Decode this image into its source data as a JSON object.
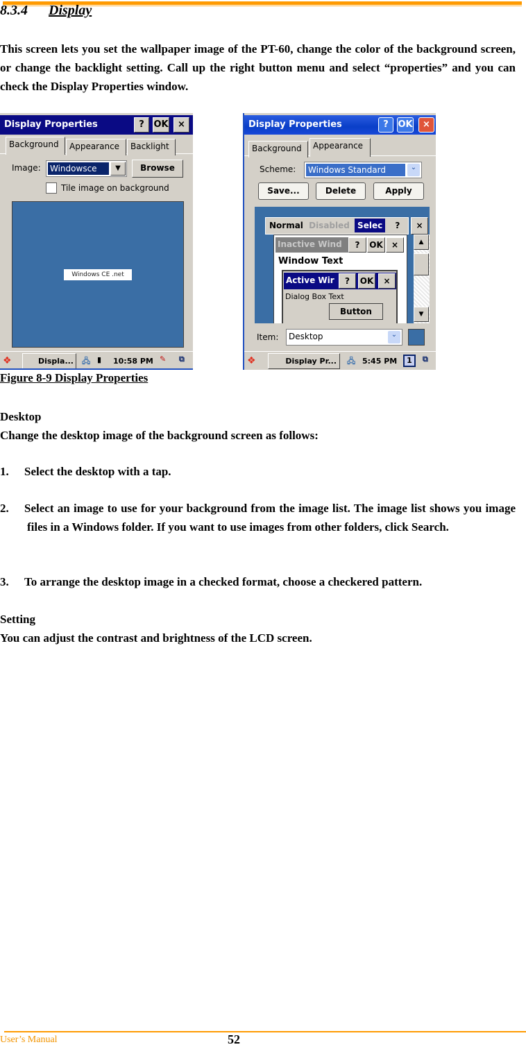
{
  "section": {
    "number": "8.3.4",
    "title": "Display"
  },
  "intro": "This screen lets you set the wallpaper image of the PT-60, change the color of the background screen, or change the backlight setting. Call up the right button menu and select “properties” and you can check the Display Properties window.",
  "figure_caption": "Figure 8-9 Display Properties",
  "shot_left": {
    "title": "Display Properties",
    "help": "?",
    "ok": "OK",
    "close": "×",
    "tabs": [
      "Background",
      "Appearance",
      "Backlight"
    ],
    "image_label": "Image:",
    "image_value": "Windowsce",
    "browse": "Browse",
    "tile_label": "Tile image on background",
    "tile_checked": false,
    "logo": "Windows CE .net",
    "task_app": "Displa...",
    "clock": "10:58 PM",
    "desktop_color": "#3a6ea5"
  },
  "shot_right": {
    "title": "Display Properties",
    "help": "?",
    "ok": "OK",
    "close": "×",
    "tabs": [
      "Background",
      "Appearance"
    ],
    "scheme_label": "Scheme:",
    "scheme_value": "Windows Standard",
    "save": "Save...",
    "delete": "Delete",
    "apply": "Apply",
    "preview": {
      "normal": "Normal",
      "disabled": "Disabled",
      "selected": "Selec",
      "help": "?",
      "close": "×",
      "inactive": "Inactive Wind",
      "ok": "OK",
      "window_text": "Window Text",
      "active": "Active Wir",
      "dialog_text": "Dialog Box Text",
      "button": "Button"
    },
    "item_label": "Item:",
    "item_value": "Desktop",
    "task_app": "Display Pr...",
    "clock": "5:45 PM",
    "input_indicator": "1"
  },
  "desktop": {
    "heading": "Desktop",
    "text": "Change the desktop image of the background screen as follows:"
  },
  "steps": [
    {
      "n": "1.",
      "text": "Select the desktop with a tap."
    },
    {
      "n": "2.",
      "text": "Select an image to use for your background from the image list. The image list shows you image files in a Windows folder. If you want to use images from other folders, click Search."
    },
    {
      "n": "3.",
      "text": "To arrange the desktop image in a checked format, choose a checkered pattern."
    }
  ],
  "setting": {
    "heading": "Setting",
    "text": "You can adjust the contrast and brightness of the LCD screen."
  },
  "footer": {
    "label": "User’s Manual",
    "page": "52"
  }
}
